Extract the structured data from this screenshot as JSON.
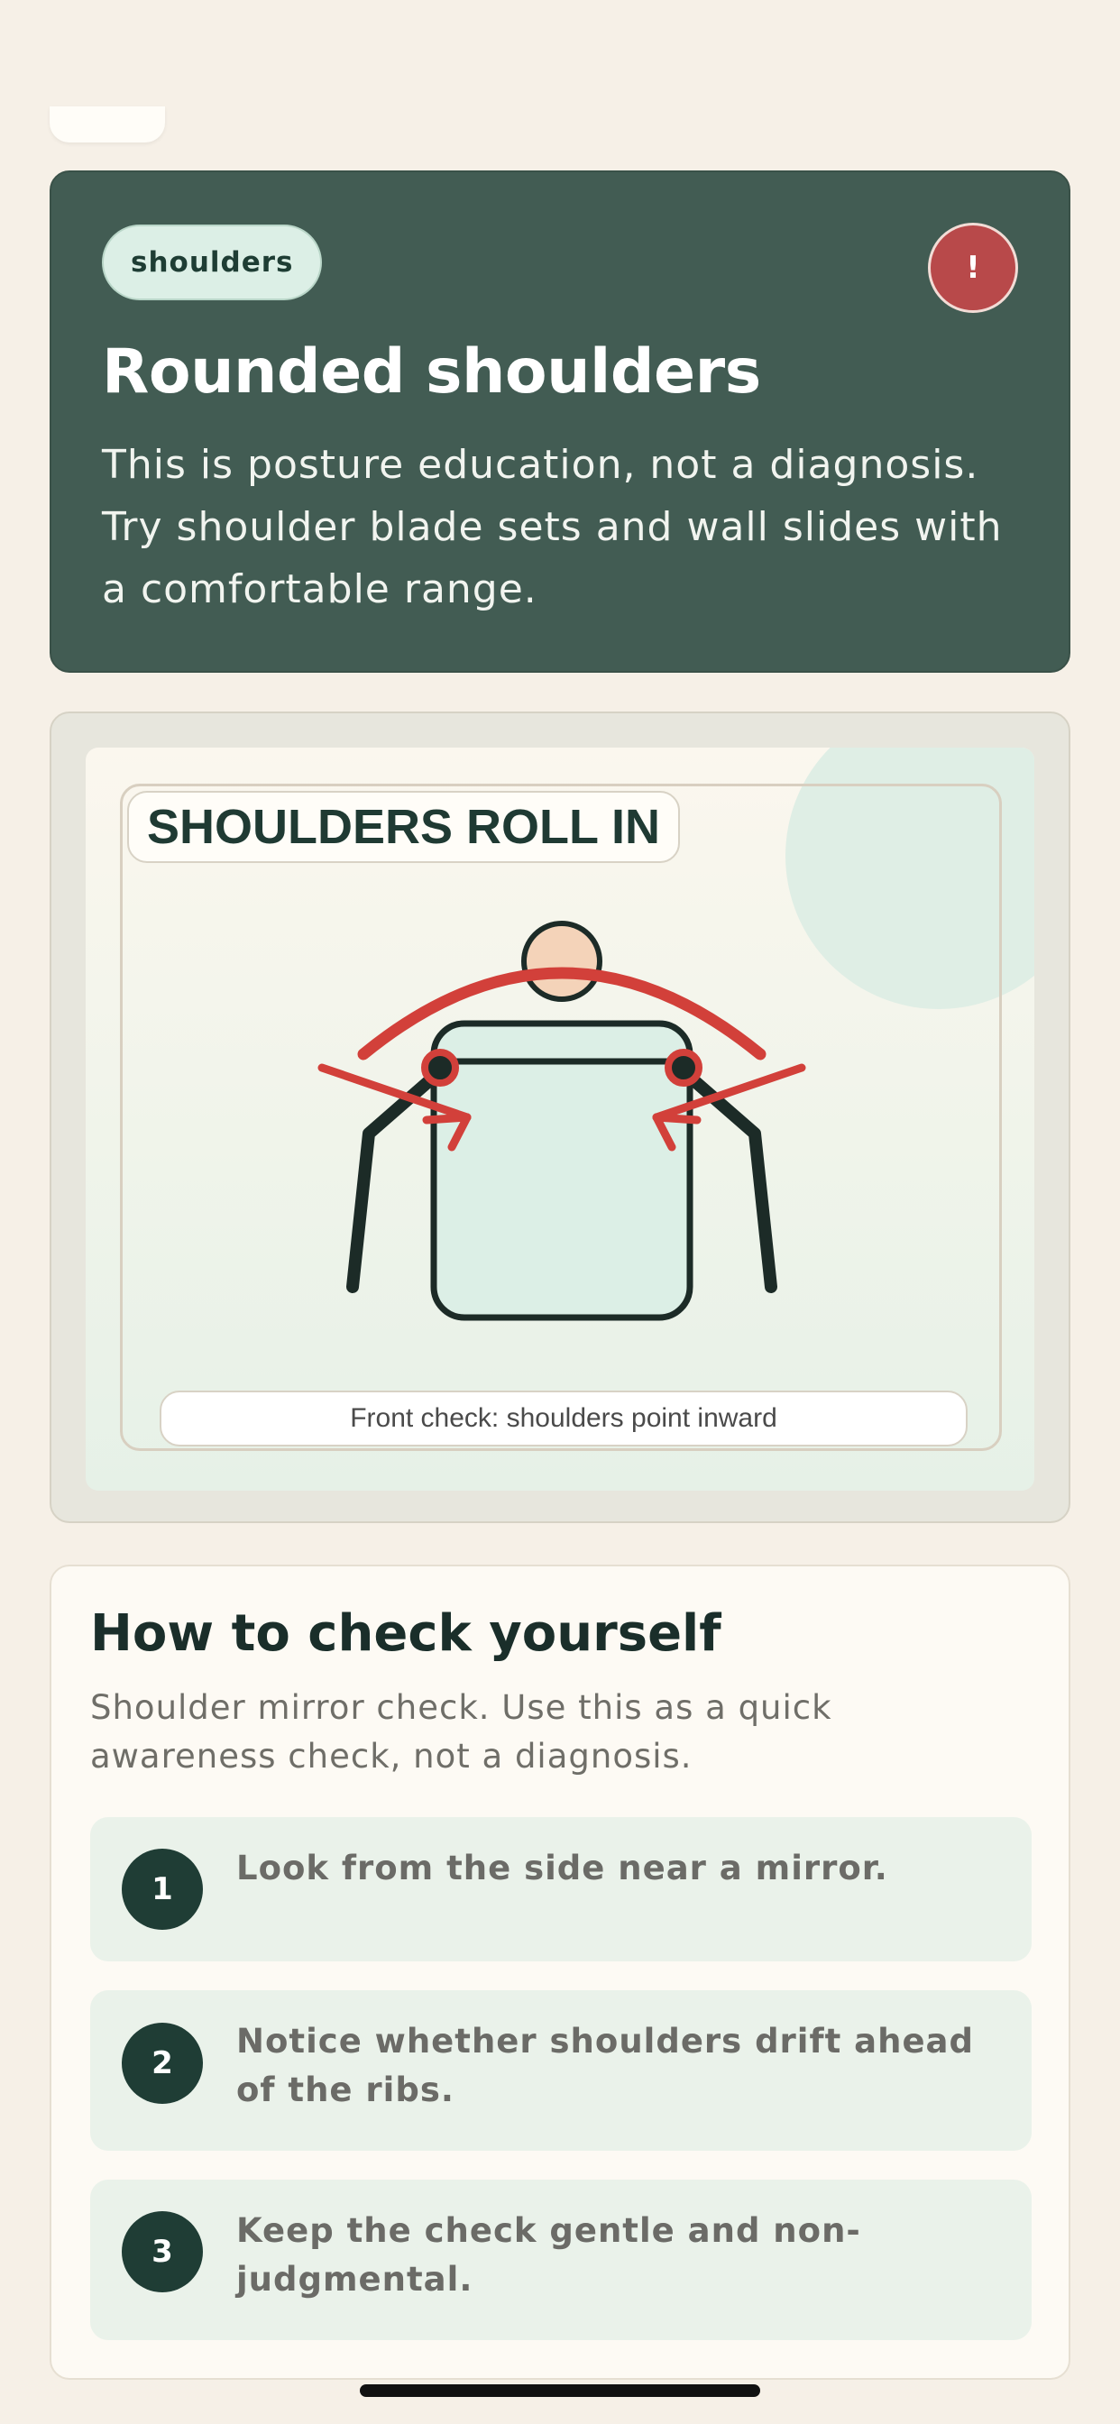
{
  "hero": {
    "chip": "shoulders",
    "alert_symbol": "!",
    "alert_icon": "alert-icon",
    "title": "Rounded shoulders",
    "body": "This is posture education, not a diagnosis. Try shoulder blade sets and wall slides with a comfortable range.",
    "background_color": "#425c53",
    "alert_color": "#b8494a"
  },
  "illustration": {
    "label": "SHOULDERS ROLL IN",
    "caption": "Front check: shoulders point inward",
    "highlight_color": "#d2403a"
  },
  "check": {
    "title": "How to check yourself",
    "subtitle": "Shoulder mirror check. Use this as a quick awareness check, not a diagnosis.",
    "steps": [
      {
        "num": "1",
        "text": "Look from the side near a mirror."
      },
      {
        "num": "2",
        "text": "Notice whether shoulders drift ahead of the ribs."
      },
      {
        "num": "3",
        "text": "Keep the check gentle and non-judgmental."
      }
    ]
  }
}
